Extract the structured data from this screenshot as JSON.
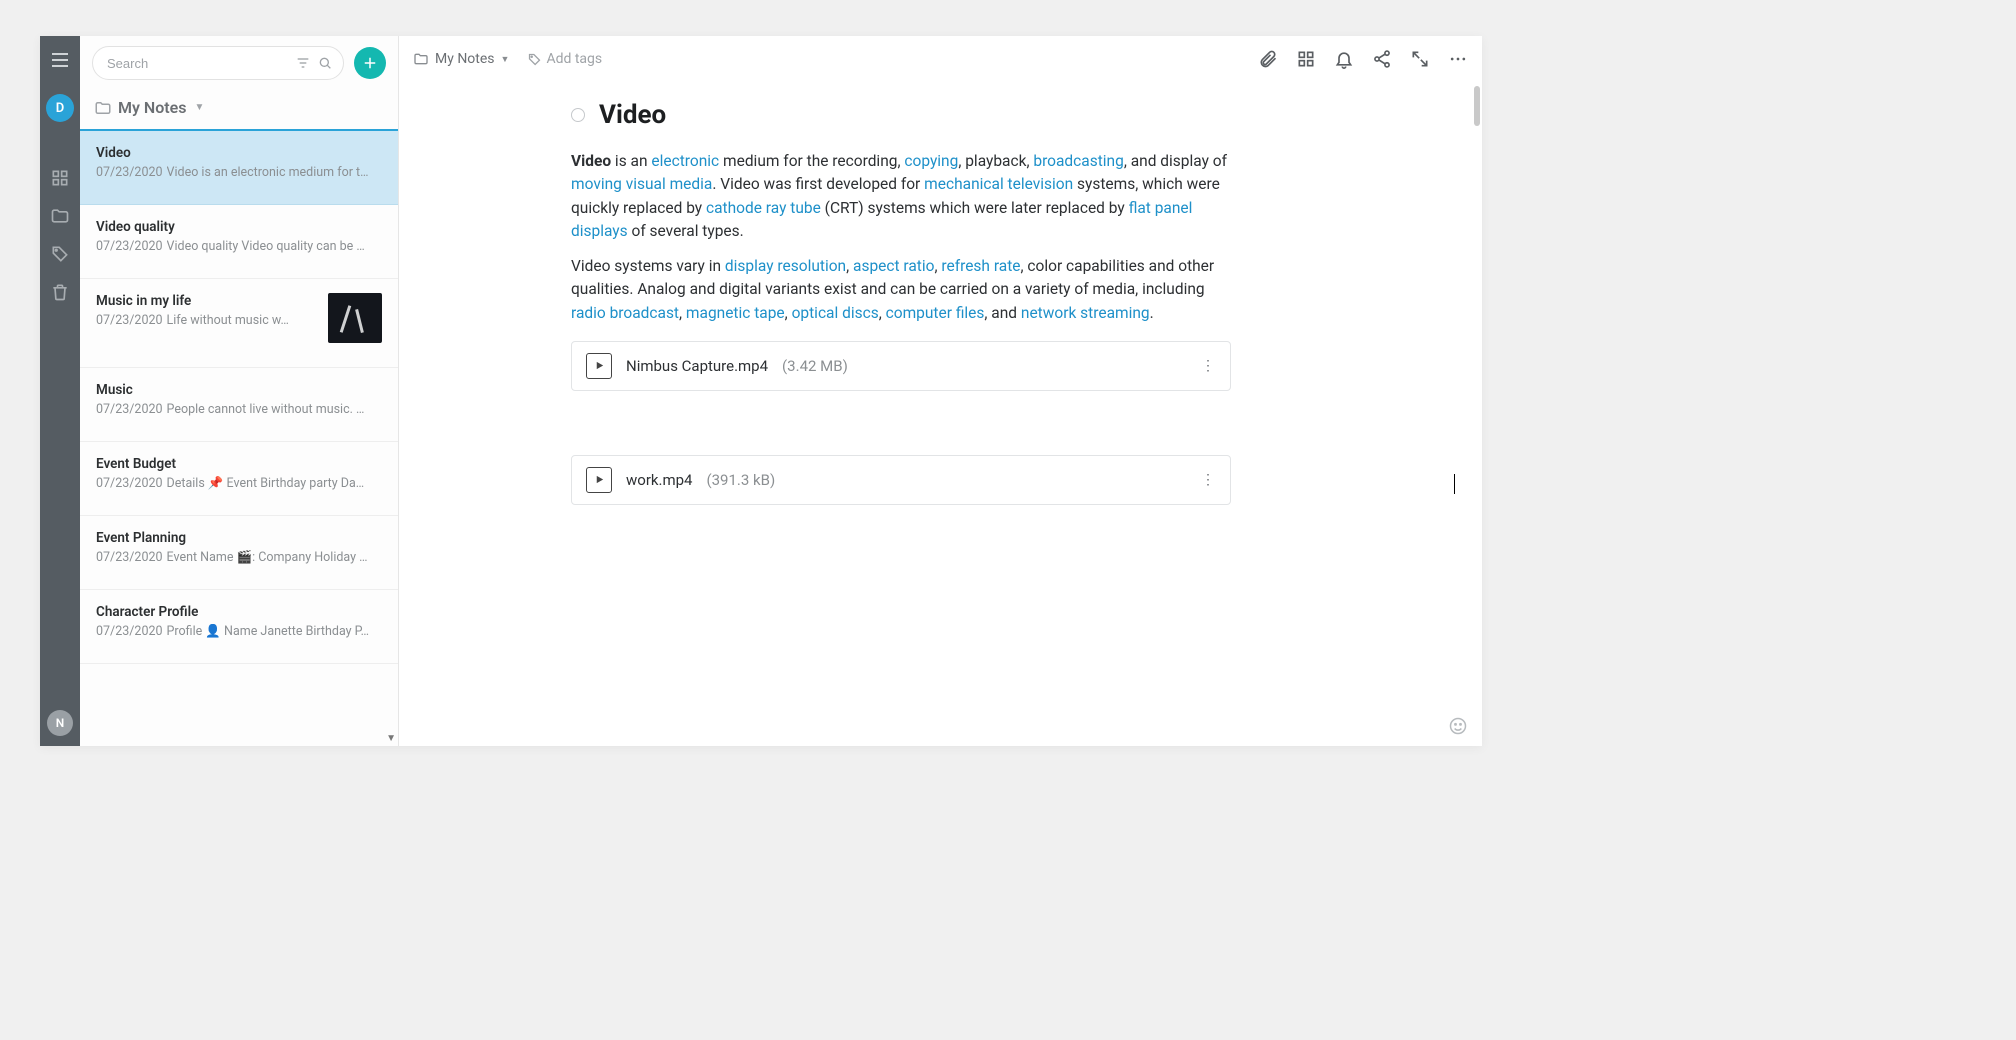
{
  "rail": {
    "avatar_letter": "D",
    "bottom_avatar_letter": "N"
  },
  "search": {
    "placeholder": "Search"
  },
  "list": {
    "folder_label": "My Notes",
    "items": [
      {
        "title": "Video",
        "date": "07/23/2020",
        "snippet": "Video is an electronic medium for t…",
        "selected": true,
        "thumb": false
      },
      {
        "title": "Video quality",
        "date": "07/23/2020",
        "snippet": "Video quality Video quality can be …",
        "selected": false,
        "thumb": false
      },
      {
        "title": "Music in my life",
        "date": "07/23/2020",
        "snippet": "Life without music w…",
        "selected": false,
        "thumb": true
      },
      {
        "title": "Music",
        "date": "07/23/2020",
        "snippet": "People cannot live without music. …",
        "selected": false,
        "thumb": false
      },
      {
        "title": "Event Budget",
        "date": "07/23/2020",
        "snippet": "Details 📌 Event Birthday party Da…",
        "selected": false,
        "thumb": false
      },
      {
        "title": "Event Planning",
        "date": "07/23/2020",
        "snippet": "Event Name 🎬: Company Holiday …",
        "selected": false,
        "thumb": false
      },
      {
        "title": "Character Profile",
        "date": "07/23/2020",
        "snippet": "Profile 👤 Name Janette Birthday P…",
        "selected": false,
        "thumb": false
      }
    ]
  },
  "editor": {
    "breadcrumb_folder": "My Notes",
    "add_tags_label": "Add tags",
    "title": "Video",
    "paragraphs": [
      [
        {
          "t": "Video",
          "b": true
        },
        {
          "t": " is an "
        },
        {
          "t": "electronic",
          "a": true
        },
        {
          "t": " medium for the recording, "
        },
        {
          "t": "copying",
          "a": true
        },
        {
          "t": ", playback, "
        },
        {
          "t": "broadcasting",
          "a": true
        },
        {
          "t": ", and display of "
        },
        {
          "t": "moving visual media",
          "a": true
        },
        {
          "t": ". Video was first developed for "
        },
        {
          "t": "mechanical television",
          "a": true
        },
        {
          "t": " systems, which were quickly replaced by "
        },
        {
          "t": "cathode ray tube",
          "a": true
        },
        {
          "t": " (CRT) systems which were later replaced by "
        },
        {
          "t": "flat panel displays",
          "a": true
        },
        {
          "t": " of several types."
        }
      ],
      [
        {
          "t": "Video systems vary in "
        },
        {
          "t": "display resolution",
          "a": true
        },
        {
          "t": ", "
        },
        {
          "t": "aspect ratio",
          "a": true
        },
        {
          "t": ", "
        },
        {
          "t": "refresh rate",
          "a": true
        },
        {
          "t": ", color capabilities and other qualities. Analog and digital variants exist and can be carried on a variety of media, including "
        },
        {
          "t": "radio broadcast",
          "a": true
        },
        {
          "t": ", "
        },
        {
          "t": "magnetic tape",
          "a": true
        },
        {
          "t": ", "
        },
        {
          "t": "optical discs",
          "a": true
        },
        {
          "t": ", "
        },
        {
          "t": "computer files",
          "a": true
        },
        {
          "t": ", and "
        },
        {
          "t": "network streaming",
          "a": true
        },
        {
          "t": "."
        }
      ]
    ],
    "attachments": [
      {
        "name": "Nimbus Capture.mp4",
        "size": "(3.42 MB)"
      },
      {
        "name": "work.mp4",
        "size": "(391.3 kB)"
      }
    ]
  }
}
